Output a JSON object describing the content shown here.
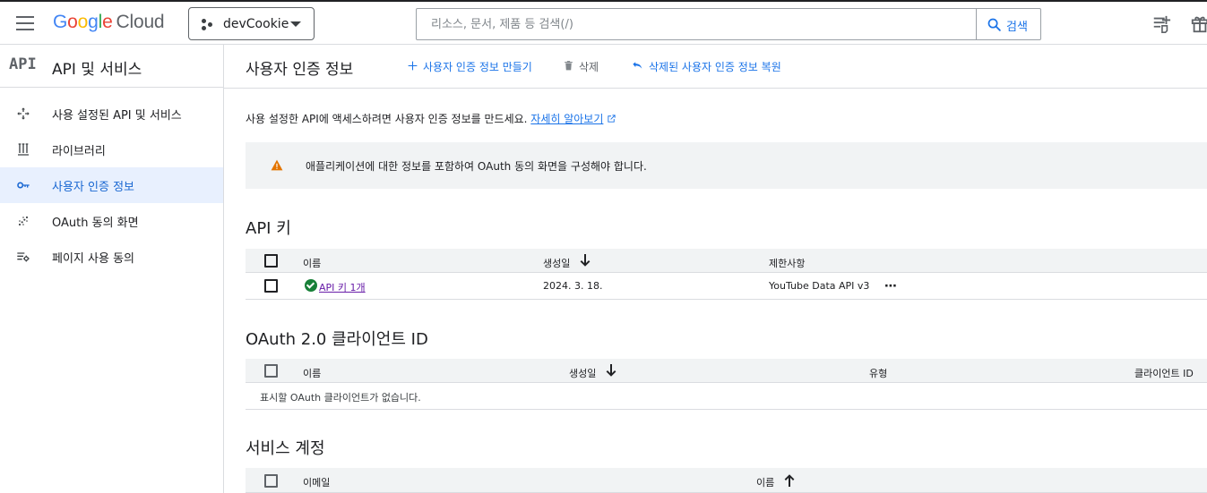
{
  "header": {
    "logo": {
      "google": [
        "G",
        "o",
        "o",
        "g",
        "l",
        "e"
      ],
      "cloud": "Cloud"
    },
    "project": "devCookie",
    "search": {
      "placeholder": "리소스, 문서, 제품 등 검색(/)",
      "button_label": "검색"
    },
    "icons": [
      "menu-icon",
      "dots-project-icon",
      "search-icon",
      "notes-icon",
      "gift-icon"
    ]
  },
  "sidebar": {
    "title": "API 및 서비스",
    "glyph": "API",
    "items": [
      {
        "label": "사용 설정된 API 및 서비스",
        "icon": "move-arrows-icon",
        "active": false
      },
      {
        "label": "라이브러리",
        "icon": "library-icon",
        "active": false
      },
      {
        "label": "사용자 인증 정보",
        "icon": "key-icon",
        "active": true
      },
      {
        "label": "OAuth 동의 화면",
        "icon": "dots-grid-icon",
        "active": false
      },
      {
        "label": "페이지 사용 동의",
        "icon": "settings-list-icon",
        "active": false
      }
    ]
  },
  "main": {
    "title": "사용자 인증 정보",
    "actions": {
      "create": "사용자 인증 정보 만들기",
      "delete": "삭제",
      "restore": "삭제된 사용자 인증 정보 복원"
    },
    "intro": {
      "text": "사용 설정한 API에 액세스하려면 사용자 인증 정보를 만드세요.",
      "link": "자세히 알아보기"
    },
    "warning": "애플리케이션에 대한 정보를 포함하여 OAuth 동의 화면을 구성해야 합니다.",
    "api_keys": {
      "title": "API 키",
      "columns": [
        "이름",
        "생성일",
        "제한사항"
      ],
      "rows": [
        {
          "name": "API 키 1개",
          "created": "2024. 3. 18.",
          "restriction": "YouTube Data API v3",
          "more": "⋯"
        }
      ]
    },
    "oauth": {
      "title": "OAuth 2.0 클라이언트 ID",
      "columns": [
        "이름",
        "생성일",
        "유형",
        "클라이언트 ID"
      ],
      "empty": "표시할 OAuth 클라이언트가 없습니다."
    },
    "service_accounts": {
      "title": "서비스 계정",
      "columns": [
        "이메일",
        "이름"
      ]
    }
  },
  "colors": {
    "accent": "#1a73e8",
    "active_bg": "#e8f0fe",
    "warning": "#e37400",
    "ok": "#188038",
    "link_visited": "#681da8"
  }
}
